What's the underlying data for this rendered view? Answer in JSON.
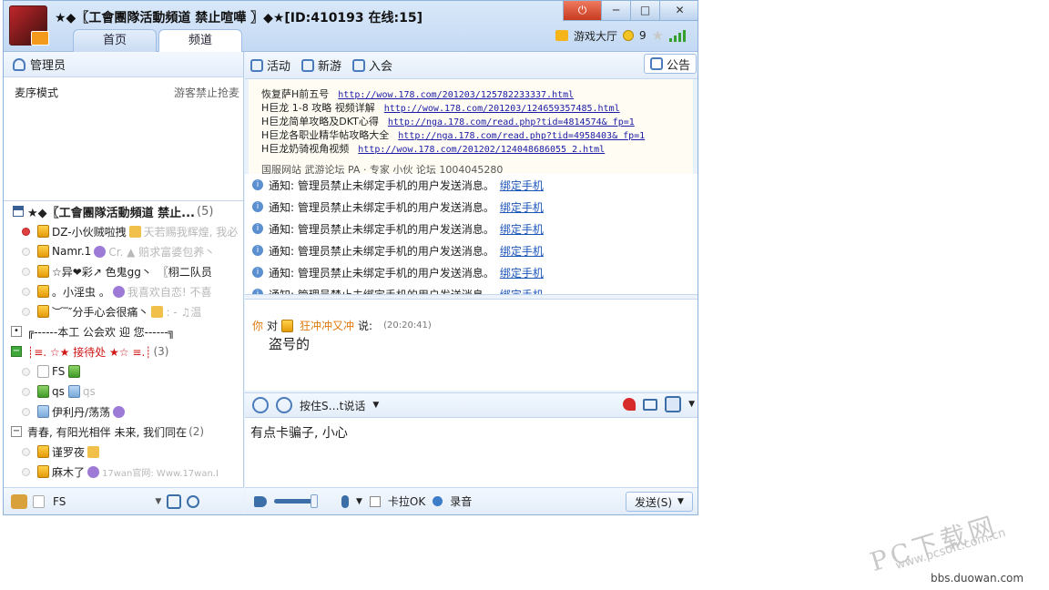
{
  "titlebar": {
    "channel_title": "★◆〖工會團隊活動頻道 禁止喧嘩 〗◆★[ID:410193 在线:15]",
    "tabs": [
      {
        "label": "首页"
      },
      {
        "label": "频道"
      }
    ],
    "game_hall": "游戏大厅",
    "coins": "9"
  },
  "left": {
    "admin_label": "管理员",
    "mode_label": "麦序模式",
    "mode_right": "游客禁止抢麦",
    "tree": {
      "channel": {
        "name": "★◆〖工會團隊活動頻道 禁止...",
        "count": "(5)"
      },
      "members": [
        {
          "name": "DZ-小伙贼啦拽",
          "extra": "天若赐我辉煌, 我必"
        },
        {
          "name": "Namr.1",
          "extra": "Cr. ▲ 赔求富婆包养丶"
        },
        {
          "name": "☆异❤彩↗  色鬼gg丶",
          "extra": "〖栩二队员"
        },
        {
          "name": "。小淫虫 。",
          "extra": "我喜欢自恋! 不喜"
        },
        {
          "name": "︶‾″分手心会很痛丶",
          "extra": ": - ♫温"
        }
      ],
      "group1": {
        "name": "╔------本工 公会欢 迎 您------╗"
      },
      "group2": {
        "name": "┊≡. ☆★ 接待处 ★☆ ≡.┊",
        "count": "(3)"
      },
      "group2_members": [
        {
          "name": "FS"
        },
        {
          "name": "qs",
          "extra": "qs"
        },
        {
          "name": "伊利丹/荡荡",
          "extra": ""
        }
      ],
      "group3": {
        "name": "青春, 有阳光相伴 未来, 我们同在",
        "count": "(2)"
      },
      "group3_members": [
        {
          "name": "谨罗夜",
          "extra": ""
        },
        {
          "name": "麻木了",
          "extra": "17wan官网: Www.17wan.I"
        }
      ]
    },
    "bottom_user": "FS"
  },
  "right": {
    "toolbar": {
      "activity": "活动",
      "newgame": "新游",
      "join": "入会",
      "notice": "公告"
    },
    "announcement": [
      {
        "text": "恢复萨H前五号",
        "link": "http://wow.178.com/201203/125782233337.html"
      },
      {
        "text": "H巨龙  1-8 攻略 视频详解",
        "link": "http://wow.178.com/201203/124659357485.html"
      },
      {
        "text": "H巨龙简单攻略及DKT心得",
        "link": "http://nga.178.com/read.php?tid=4814574& fp=1"
      },
      {
        "text": "H巨龙各职业精华帖攻略大全",
        "link": "http://nga.178.com/read.php?tid=4958403& fp=1"
      },
      {
        "text": "H巨龙奶骑视角视频",
        "link": "http://wow.178.com/201202/124048686055 2.html"
      }
    ],
    "announcement_cut": "国服网站    武游论坛    PA   ·   专家 小伙   论坛   1004045280",
    "system_msgs": [
      {
        "text": "通知: 管理员禁止未绑定手机的用户发送消息。",
        "link": "绑定手机"
      },
      {
        "text": "通知: 管理员禁止未绑定手机的用户发送消息。",
        "link": "绑定手机"
      },
      {
        "text": "通知: 管理员禁止未绑定手机的用户发送消息。",
        "link": "绑定手机"
      },
      {
        "text": "通知: 管理员禁止未绑定手机的用户发送消息。",
        "link": "绑定手机"
      },
      {
        "text": "通知: 管理员禁止未绑定手机的用户发送消息。",
        "link": "绑定手机"
      },
      {
        "text": "通知: 管理员禁止未绑定手机的用户发送消息。",
        "link": "绑定手机"
      }
    ],
    "chat": {
      "you": "你",
      "to": "对",
      "target": "狂冲冲又冲",
      "says": "说:",
      "time": "(20:20:41)",
      "body": "盗号的"
    },
    "input_bar": {
      "ptt_label": "按住S…t说话"
    },
    "input_text": "有点卡骗子, 小心",
    "send_bar": {
      "karaoke": "卡拉OK",
      "record": "录音",
      "send": "发送(S)"
    }
  },
  "watermark": {
    "brand": "PC下载网",
    "url": "www.pcsoft.com.cn",
    "site": "bbs.duowan.com"
  }
}
